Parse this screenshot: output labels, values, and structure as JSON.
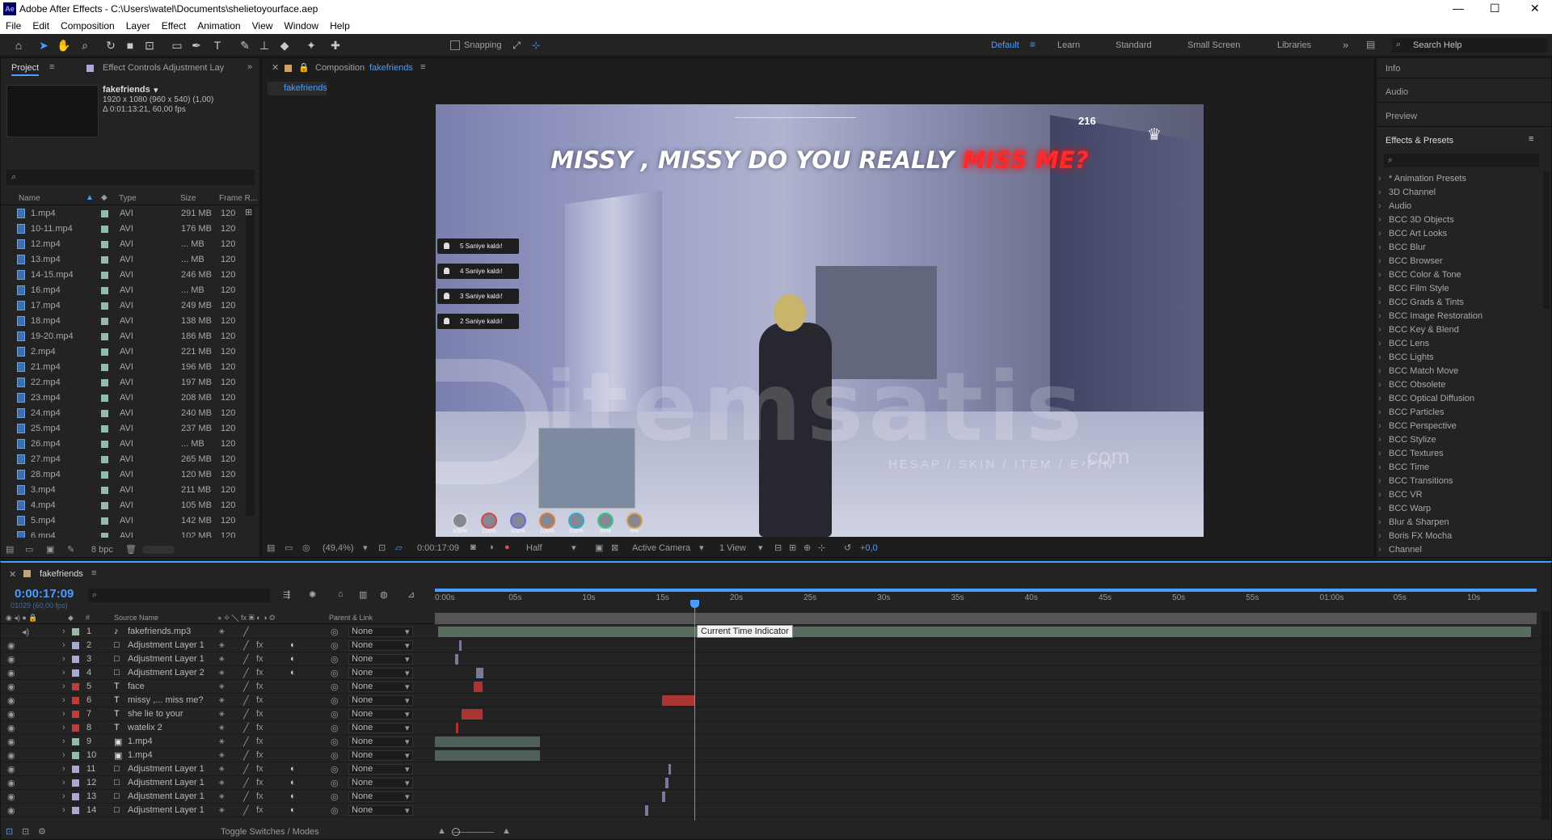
{
  "titlebar": {
    "title": "Adobe After Effects - C:\\Users\\watel\\Documents\\shelietoyourface.aep",
    "app_icon": "Ae",
    "minimize": "—",
    "maximize": "☐",
    "close": "✕"
  },
  "menu": [
    "File",
    "Edit",
    "Composition",
    "Layer",
    "Effect",
    "Animation",
    "View",
    "Window",
    "Help"
  ],
  "toolbar": {
    "snapping": "Snapping",
    "workspaces": [
      "Default",
      "Learn",
      "Standard",
      "Small Screen",
      "Libraries"
    ],
    "search": "Search Help"
  },
  "project": {
    "tab": "Project",
    "tab2": "Effect Controls Adjustment Lay",
    "item_name": "fakefriends",
    "item_res": "1920 x 1080  (960 x 540) (1,00)",
    "item_dur": "Δ 0:01:13:21, 60,00 fps",
    "columns": [
      "Name",
      "Type",
      "Size",
      "Frame R..."
    ],
    "bpc": "8 bpc",
    "files": [
      {
        "name": "1.mp4",
        "type": "AVI",
        "size": "291 MB",
        "fr": "120"
      },
      {
        "name": "10-11.mp4",
        "type": "AVI",
        "size": "176 MB",
        "fr": "120"
      },
      {
        "name": "12.mp4",
        "type": "AVI",
        "size": "... MB",
        "fr": "120"
      },
      {
        "name": "13.mp4",
        "type": "AVI",
        "size": "... MB",
        "fr": "120"
      },
      {
        "name": "14-15.mp4",
        "type": "AVI",
        "size": "246 MB",
        "fr": "120"
      },
      {
        "name": "16.mp4",
        "type": "AVI",
        "size": "... MB",
        "fr": "120"
      },
      {
        "name": "17.mp4",
        "type": "AVI",
        "size": "249 MB",
        "fr": "120"
      },
      {
        "name": "18.mp4",
        "type": "AVI",
        "size": "138 MB",
        "fr": "120"
      },
      {
        "name": "19-20.mp4",
        "type": "AVI",
        "size": "186 MB",
        "fr": "120"
      },
      {
        "name": "2.mp4",
        "type": "AVI",
        "size": "221 MB",
        "fr": "120"
      },
      {
        "name": "21.mp4",
        "type": "AVI",
        "size": "196 MB",
        "fr": "120"
      },
      {
        "name": "22.mp4",
        "type": "AVI",
        "size": "197 MB",
        "fr": "120"
      },
      {
        "name": "23.mp4",
        "type": "AVI",
        "size": "208 MB",
        "fr": "120"
      },
      {
        "name": "24.mp4",
        "type": "AVI",
        "size": "240 MB",
        "fr": "120"
      },
      {
        "name": "25.mp4",
        "type": "AVI",
        "size": "237 MB",
        "fr": "120"
      },
      {
        "name": "26.mp4",
        "type": "AVI",
        "size": "... MB",
        "fr": "120"
      },
      {
        "name": "27.mp4",
        "type": "AVI",
        "size": "265 MB",
        "fr": "120"
      },
      {
        "name": "28.mp4",
        "type": "AVI",
        "size": "120 MB",
        "fr": "120"
      },
      {
        "name": "3.mp4",
        "type": "AVI",
        "size": "211 MB",
        "fr": "120"
      },
      {
        "name": "4.mp4",
        "type": "AVI",
        "size": "105 MB",
        "fr": "120"
      },
      {
        "name": "5.mp4",
        "type": "AVI",
        "size": "142 MB",
        "fr": "120"
      },
      {
        "name": "6.mp4",
        "type": "AVI",
        "size": "102 MB",
        "fr": "120"
      }
    ]
  },
  "composition": {
    "tab_prefix": "Composition",
    "tab_name": "fakefriends",
    "subtab": "fakefriends",
    "caption_white": "MISSY , MISSY DO YOU REALLY ",
    "caption_red": "MISS ME?",
    "hud_speed": "216",
    "notifications": [
      "5 Saniye kaldı!",
      "4 Saniye kaldı!",
      "3 Saniye kaldı!",
      "2 Saniye kaldı!"
    ],
    "stats": [
      "100%",
      "100%",
      "100%",
      "100%",
      "100%",
      "99%",
      "0%"
    ],
    "watermark": "itemsatis",
    "watermark_sub": "HESAP / SKIN / ITEM / E-PIN",
    "watermark_com": ".com",
    "footer": {
      "zoom": "(49,4%)",
      "time": "0:00:17:09",
      "resolution": "Half",
      "camera": "Active Camera",
      "views": "1 View",
      "exposure": "+0,0"
    }
  },
  "right": {
    "sections": [
      "Info",
      "Audio",
      "Preview"
    ],
    "effects_title": "Effects & Presets",
    "effects": [
      "* Animation Presets",
      "3D Channel",
      "Audio",
      "BCC 3D Objects",
      "BCC Art Looks",
      "BCC Blur",
      "BCC Browser",
      "BCC Color & Tone",
      "BCC Film Style",
      "BCC Grads & Tints",
      "BCC Image Restoration",
      "BCC Key & Blend",
      "BCC Lens",
      "BCC Lights",
      "BCC Match Move",
      "BCC Obsolete",
      "BCC Optical Diffusion",
      "BCC Particles",
      "BCC Perspective",
      "BCC Stylize",
      "BCC Textures",
      "BCC Time",
      "BCC Transitions",
      "BCC VR",
      "BCC Warp",
      "Blur & Sharpen",
      "Boris FX Mocha",
      "Channel"
    ]
  },
  "timeline": {
    "tab": "fakefriends",
    "timecode": "0:00:17:09",
    "frames": "01029 (60,00 fps)",
    "col_source": "Source Name",
    "col_parent": "Parent & Link",
    "toggle": "Toggle Switches / Modes",
    "tooltip": "Current Time Indicator",
    "ticks": [
      "0:00s",
      "05s",
      "10s",
      "15s",
      "20s",
      "25s",
      "30s",
      "35s",
      "40s",
      "45s",
      "50s",
      "55s",
      "01:00s",
      "05s",
      "10s"
    ],
    "layers": [
      {
        "num": "1",
        "name": "fakefriends.mp3",
        "kind": "audio",
        "color": "#8fbfa8",
        "parent": "None"
      },
      {
        "num": "2",
        "name": "Adjustment Layer 1",
        "kind": "adj",
        "color": "#a9a9d6",
        "parent": "None"
      },
      {
        "num": "3",
        "name": "Adjustment Layer 1",
        "kind": "adj",
        "color": "#a9a9d6",
        "parent": "None"
      },
      {
        "num": "4",
        "name": "Adjustment Layer 2",
        "kind": "adj",
        "color": "#a9a9d6",
        "parent": "None"
      },
      {
        "num": "5",
        "name": "face",
        "kind": "T",
        "color": "#c23b3b",
        "parent": "None"
      },
      {
        "num": "6",
        "name": "missy ,... miss me?",
        "kind": "T",
        "color": "#c23b3b",
        "parent": "None"
      },
      {
        "num": "7",
        "name": "she lie to your",
        "kind": "T",
        "color": "#c23b3b",
        "parent": "None"
      },
      {
        "num": "8",
        "name": "watelix 2",
        "kind": "T",
        "color": "#c23b3b",
        "parent": "None"
      },
      {
        "num": "9",
        "name": "1.mp4",
        "kind": "video",
        "color": "#8fbfa8",
        "parent": "None"
      },
      {
        "num": "10",
        "name": "1.mp4",
        "kind": "video",
        "color": "#8fbfa8",
        "parent": "None"
      },
      {
        "num": "11",
        "name": "Adjustment Layer 1",
        "kind": "adj",
        "color": "#a9a9d6",
        "parent": "None"
      },
      {
        "num": "12",
        "name": "Adjustment Layer 1",
        "kind": "adj",
        "color": "#a9a9d6",
        "parent": "None"
      },
      {
        "num": "13",
        "name": "Adjustment Layer 1",
        "kind": "adj",
        "color": "#a9a9d6",
        "parent": "None"
      },
      {
        "num": "14",
        "name": "Adjustment Layer 1",
        "kind": "adj",
        "color": "#a9a9d6",
        "parent": "None"
      }
    ]
  }
}
